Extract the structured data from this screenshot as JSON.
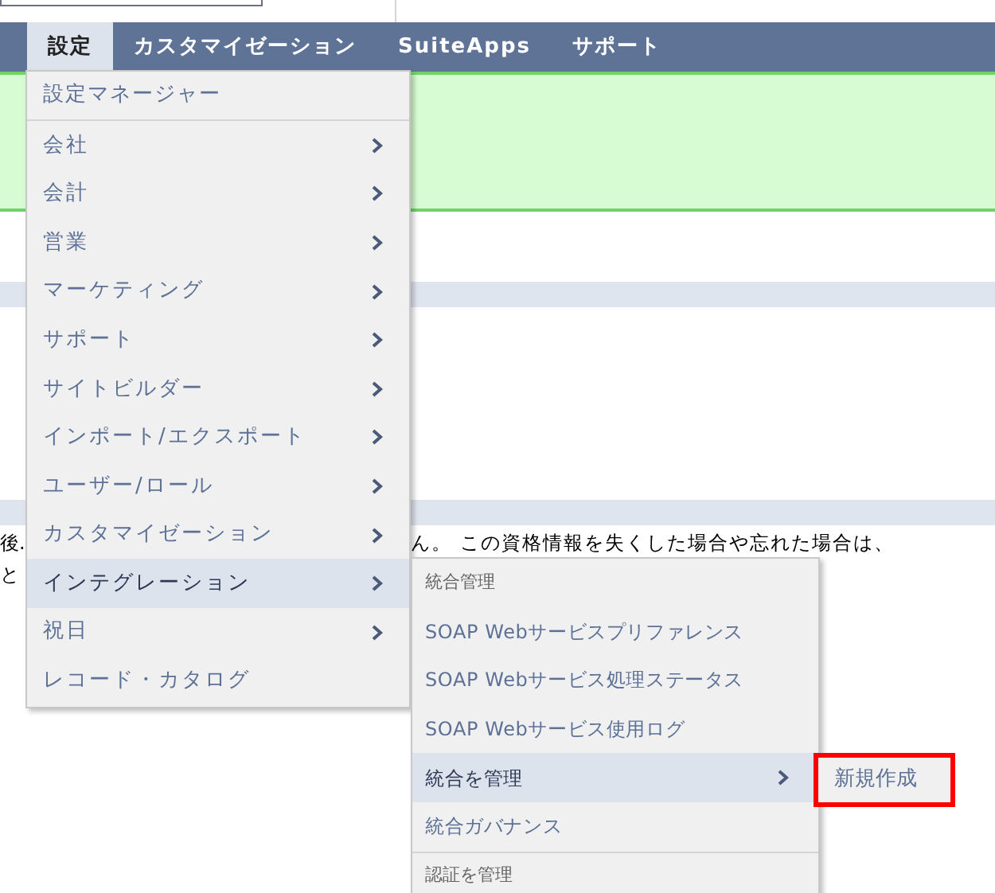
{
  "nav": {
    "tabs": [
      {
        "label": "設定",
        "selected": true
      },
      {
        "label": "カスタマイゼーション",
        "selected": false
      },
      {
        "label": "SuiteApps",
        "selected": false
      },
      {
        "label": "サポート",
        "selected": false
      }
    ]
  },
  "content": {
    "line_1_left": "後.",
    "line_1_right": "ん。 この資格情報を失くした場合や忘れた場合は、",
    "line_2_left": "と"
  },
  "menu": {
    "header": "設定マネージャー",
    "items": [
      {
        "label": "会社",
        "has_arrow": true,
        "selected": false
      },
      {
        "label": "会計",
        "has_arrow": true,
        "selected": false
      },
      {
        "label": "営業",
        "has_arrow": true,
        "selected": false
      },
      {
        "label": "マーケティング",
        "has_arrow": true,
        "selected": false
      },
      {
        "label": "サポート",
        "has_arrow": true,
        "selected": false
      },
      {
        "label": "サイトビルダー",
        "has_arrow": true,
        "selected": false
      },
      {
        "label": "インポート/エクスポート",
        "has_arrow": true,
        "selected": false
      },
      {
        "label": "ユーザー/ロール",
        "has_arrow": true,
        "selected": false
      },
      {
        "label": "カスタマイゼーション",
        "has_arrow": true,
        "selected": false
      },
      {
        "label": "インテグレーション",
        "has_arrow": true,
        "selected": true
      },
      {
        "label": "祝日",
        "has_arrow": true,
        "selected": false
      },
      {
        "label": "レコード・カタログ",
        "has_arrow": false,
        "selected": false
      }
    ]
  },
  "submenu": {
    "items": [
      {
        "kind": "heading",
        "label": "統合管理"
      },
      {
        "kind": "link",
        "label": "SOAP Webサービスプリファレンス",
        "has_arrow": false,
        "selected": false
      },
      {
        "kind": "link",
        "label": "SOAP Webサービス処理ステータス",
        "has_arrow": false,
        "selected": false
      },
      {
        "kind": "link",
        "label": "SOAP Webサービス使用ログ",
        "has_arrow": false,
        "selected": false
      },
      {
        "kind": "link",
        "label": "統合を管理",
        "has_arrow": true,
        "selected": true
      },
      {
        "kind": "link",
        "label": "統合ガバナンス",
        "has_arrow": false,
        "selected": false
      },
      {
        "kind": "heading",
        "label": "認証を管理"
      }
    ]
  },
  "flyout": {
    "items": [
      {
        "label": "新規作成",
        "outlined": true
      }
    ]
  }
}
